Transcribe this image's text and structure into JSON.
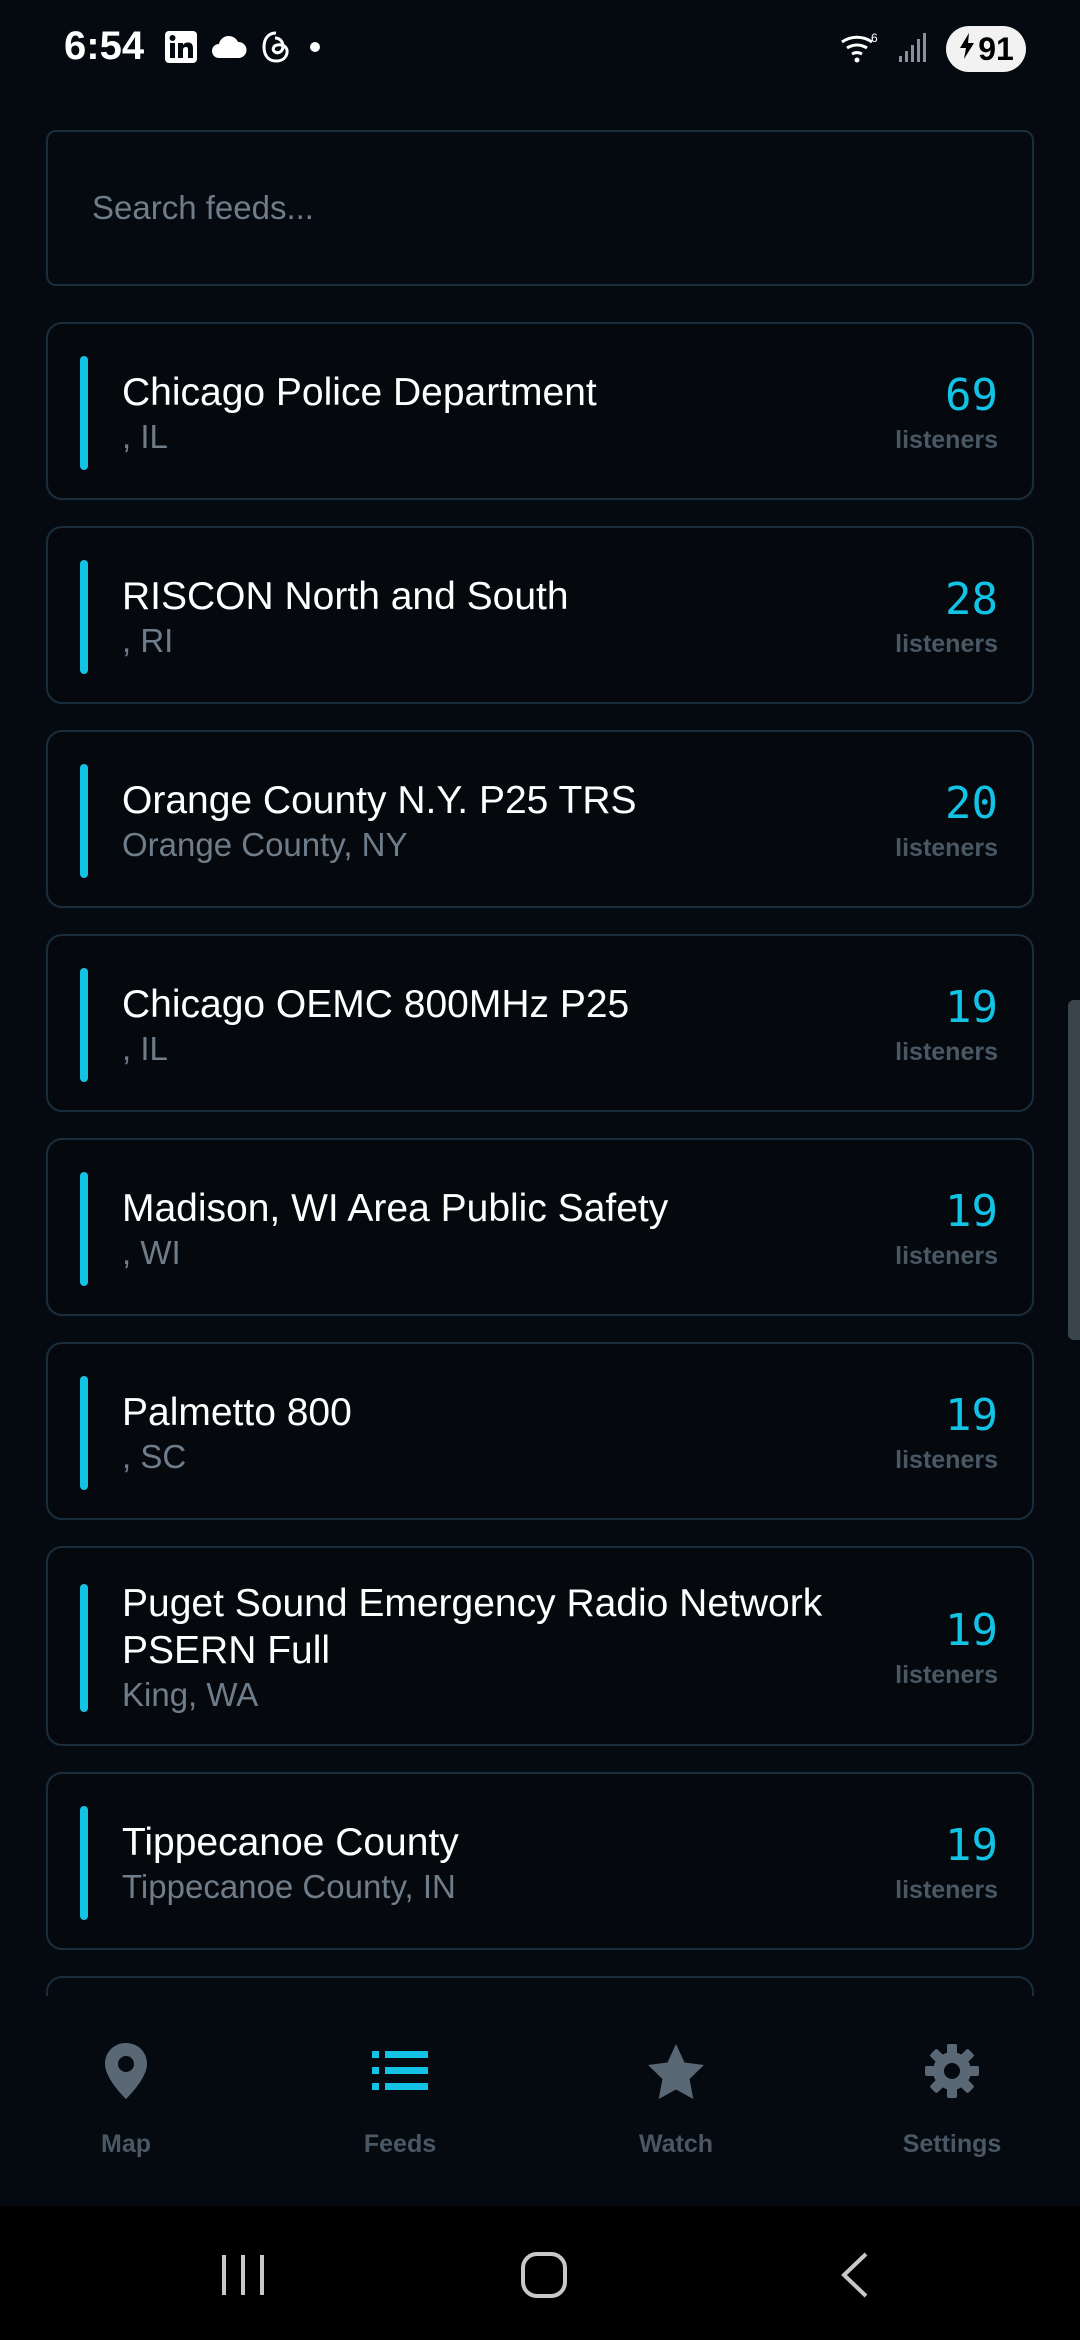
{
  "status_bar": {
    "time": "6:54",
    "battery": "91",
    "left_icons": [
      "linkedin-icon",
      "cloud-icon",
      "threads-icon",
      "dot-icon"
    ],
    "right_icons": [
      "wifi-6-icon",
      "signal-icon",
      "battery-charging-icon"
    ]
  },
  "search": {
    "placeholder": "Search feeds...",
    "value": ""
  },
  "feeds": [
    {
      "name": "Chicago Police Department",
      "location": ", IL",
      "count": "69",
      "unit": "listeners"
    },
    {
      "name": "RISCON North and South",
      "location": ", RI",
      "count": "28",
      "unit": "listeners"
    },
    {
      "name": "Orange County N.Y.  P25 TRS",
      "location": "Orange County, NY",
      "count": "20",
      "unit": "listeners"
    },
    {
      "name": "Chicago OEMC 800MHz P25",
      "location": ", IL",
      "count": "19",
      "unit": "listeners"
    },
    {
      "name": "Madison, WI Area Public Safety",
      "location": ", WI",
      "count": "19",
      "unit": "listeners"
    },
    {
      "name": "Palmetto 800",
      "location": ", SC",
      "count": "19",
      "unit": "listeners"
    },
    {
      "name": "Puget Sound Emergency Radio Network PSERN Full",
      "location": "King, WA",
      "count": "19",
      "unit": "listeners"
    },
    {
      "name": "Tippecanoe County",
      "location": "Tippecanoe County, IN",
      "count": "19",
      "unit": "listeners"
    }
  ],
  "bottom_nav": [
    {
      "label": "Map",
      "icon": "map-pin-icon",
      "active": false
    },
    {
      "label": "Feeds",
      "icon": "list-icon",
      "active": true
    },
    {
      "label": "Watch",
      "icon": "star-icon",
      "active": false
    },
    {
      "label": "Settings",
      "icon": "gear-icon",
      "active": false
    }
  ],
  "colors": {
    "background": "#050a10",
    "accent": "#12c3e6",
    "muted_text": "#6f7d8b",
    "nav_inactive": "#5a6876",
    "card_border": "#1a2d3d"
  }
}
